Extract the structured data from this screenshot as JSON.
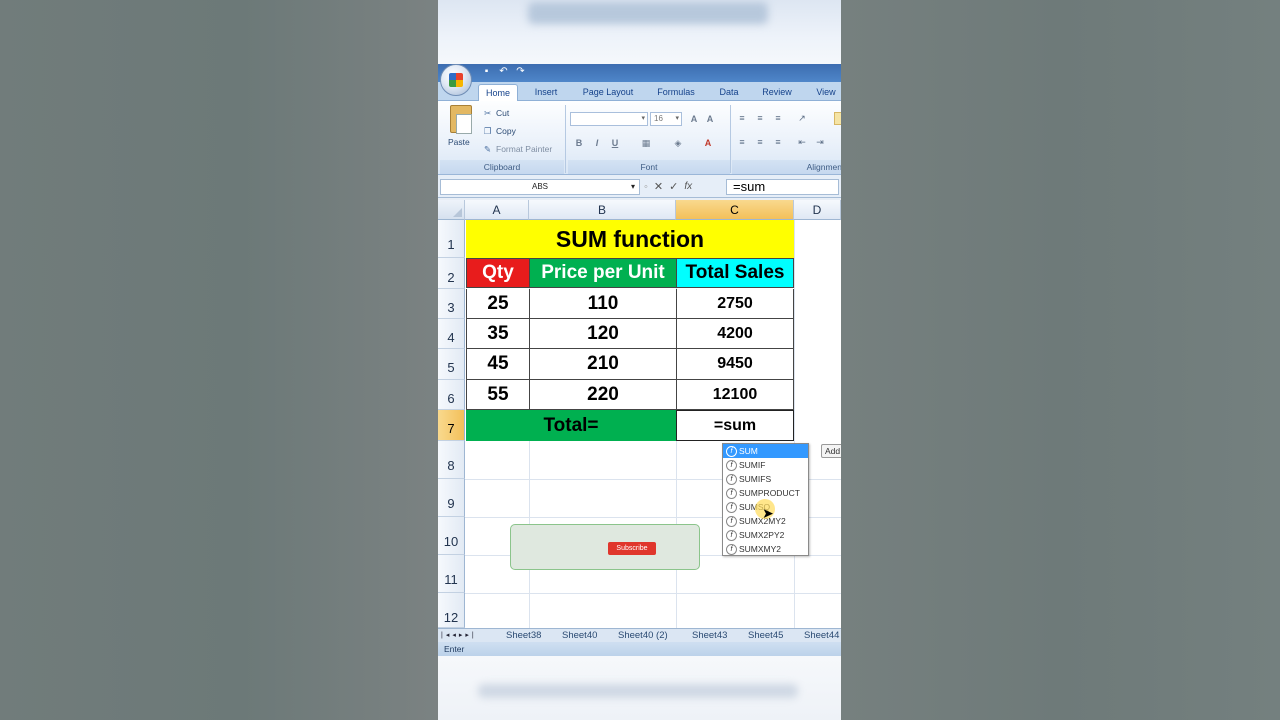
{
  "ribbon": {
    "tabs": [
      "Home",
      "Insert",
      "Page Layout",
      "Formulas",
      "Data",
      "Review",
      "View"
    ],
    "clipboard": {
      "paste": "Paste",
      "cut": "Cut",
      "copy": "Copy",
      "format_painter": "Format Painter",
      "label": "Clipboard"
    },
    "font": {
      "size": "16",
      "label": "Font",
      "bold": "B",
      "italic": "I",
      "underline": "U"
    },
    "alignment": {
      "label": "Alignmen"
    }
  },
  "formula_bar": {
    "name_box": "ABS",
    "fx": "fx",
    "value": "=sum"
  },
  "columns": [
    "A",
    "B",
    "C",
    "D"
  ],
  "rows": [
    "1",
    "2",
    "3",
    "4",
    "5",
    "6",
    "7",
    "8",
    "9",
    "10",
    "11",
    "12"
  ],
  "sheet": {
    "title": "SUM function",
    "headers": {
      "qty": "Qty",
      "price": "Price per Unit",
      "total": "Total Sales"
    },
    "data": [
      {
        "qty": "25",
        "price": "110",
        "total": "2750"
      },
      {
        "qty": "35",
        "price": "120",
        "total": "4200"
      },
      {
        "qty": "45",
        "price": "210",
        "total": "9450"
      },
      {
        "qty": "55",
        "price": "220",
        "total": "12100"
      }
    ],
    "total_label": "Total=",
    "total_formula": "=sum"
  },
  "autocomplete": {
    "items": [
      "SUM",
      "SUMIF",
      "SUMIFS",
      "SUMPRODUCT",
      "SUMSQ",
      "SUMX2MY2",
      "SUMX2PY2",
      "SUMXMY2"
    ],
    "selected": "SUM",
    "tooltip": "Add"
  },
  "overlay": {
    "subscribe": "Subscribe"
  },
  "sheet_tabs": [
    "Sheet38",
    "Sheet40",
    "Sheet40 (2)",
    "Sheet43",
    "Sheet45",
    "Sheet44"
  ],
  "status": "Enter",
  "colors": {
    "title_fill": "#ffff00",
    "qty_fill": "#e81c1c",
    "price_fill": "#00b050",
    "total_fill": "#00ffff",
    "accent": "#3399ff"
  }
}
